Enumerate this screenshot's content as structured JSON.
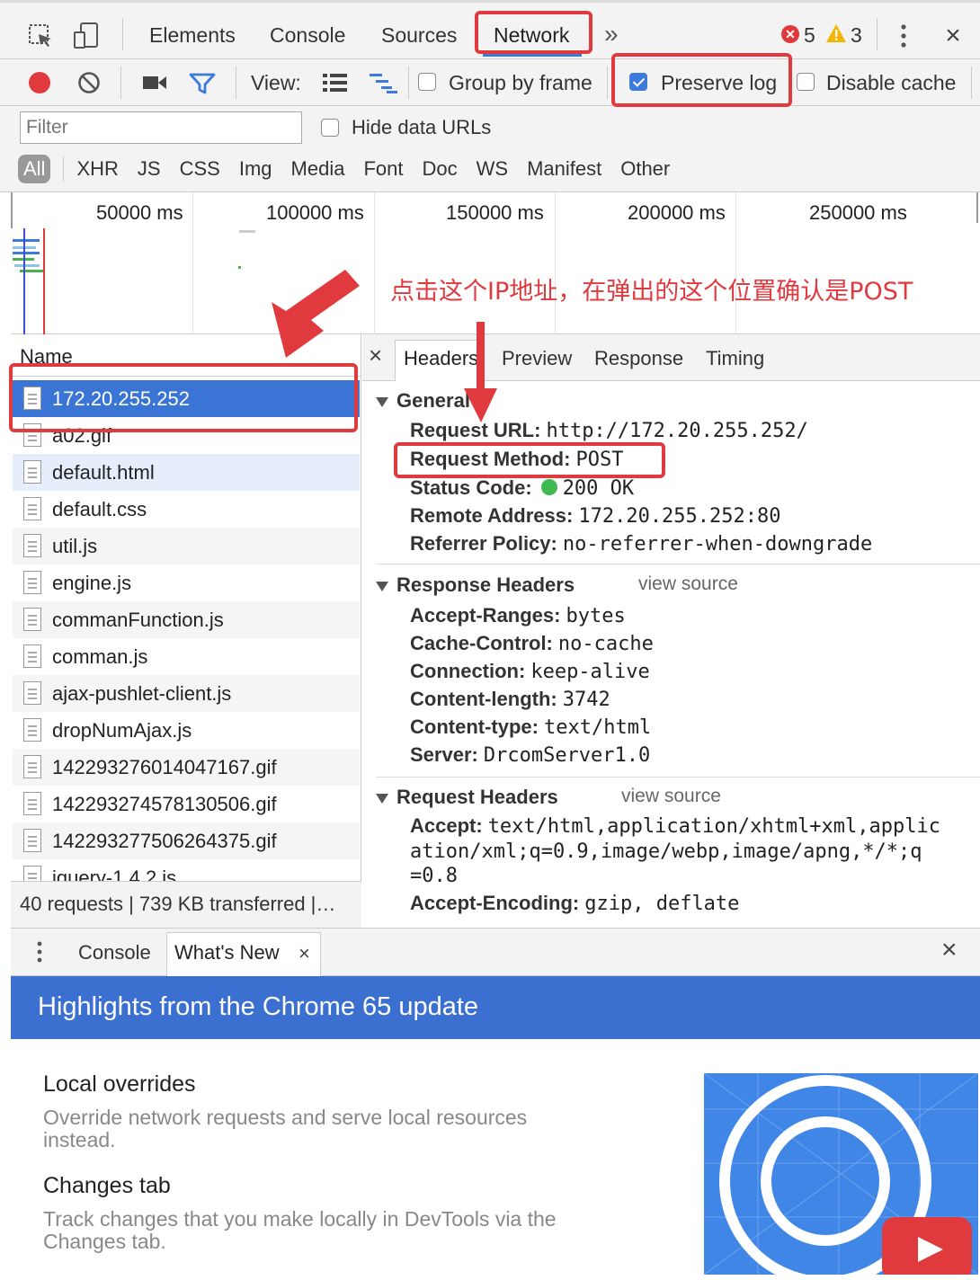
{
  "toolbar": {
    "tabs": [
      "Elements",
      "Console",
      "Sources",
      "Network"
    ],
    "more": "»",
    "errors": "5",
    "warnings": "3"
  },
  "net_toolbar": {
    "view_label": "View:",
    "group_by_frame": "Group by frame",
    "preserve_log": "Preserve log",
    "disable_cache": "Disable cache"
  },
  "filter": {
    "placeholder": "Filter",
    "hide_data_urls": "Hide data URLs",
    "types": [
      "All",
      "XHR",
      "JS",
      "CSS",
      "Img",
      "Media",
      "Font",
      "Doc",
      "WS",
      "Manifest",
      "Other"
    ]
  },
  "timeline": {
    "ticks": [
      "50000 ms",
      "100000 ms",
      "150000 ms",
      "200000 ms",
      "250000 ms"
    ]
  },
  "annotation": {
    "text": "点击这个IP地址，在弹出的这个位置确认是POST",
    "color": "#e0393e"
  },
  "requests": {
    "header": "Name",
    "items": [
      "172.20.255.252",
      "a02.gif",
      "default.html",
      "default.css",
      "util.js",
      "engine.js",
      "commanFunction.js",
      "comman.js",
      "ajax-pushlet-client.js",
      "dropNumAjax.js",
      "142293276014047167.gif",
      "142293274578130506.gif",
      "142293277506264375.gif",
      "jquery-1.4.2.js"
    ],
    "summary": "40 requests | 739 KB transferred |…"
  },
  "details": {
    "tabs": [
      "Headers",
      "Preview",
      "Response",
      "Timing"
    ],
    "close": "×",
    "general": {
      "title": "General",
      "rows": [
        {
          "k": "Request URL:",
          "v": "http://172.20.255.252/"
        },
        {
          "k": "Request Method:",
          "v": "POST"
        },
        {
          "k": "Status Code:",
          "v": "200 OK"
        },
        {
          "k": "Remote Address:",
          "v": "172.20.255.252:80"
        },
        {
          "k": "Referrer Policy:",
          "v": "no-referrer-when-downgrade"
        }
      ]
    },
    "response_headers": {
      "title": "Response Headers",
      "view_source": "view source",
      "rows": [
        {
          "k": "Accept-Ranges:",
          "v": "bytes"
        },
        {
          "k": "Cache-Control:",
          "v": "no-cache"
        },
        {
          "k": "Connection:",
          "v": "keep-alive"
        },
        {
          "k": "Content-length:",
          "v": "3742"
        },
        {
          "k": "Content-type:",
          "v": "text/html"
        },
        {
          "k": "Server:",
          "v": "DrcomServer1.0"
        }
      ]
    },
    "request_headers": {
      "title": "Request Headers",
      "view_source": "view source",
      "accept_k": "Accept:",
      "accept_v1": "text/html,application/xhtml+xml,applic",
      "accept_v2": "ation/xml;q=0.9,image/webp,image/apng,*/*;q",
      "accept_v3": "=0.8",
      "enc_k": "Accept-Encoding:",
      "enc_v": "gzip, deflate"
    }
  },
  "drawer": {
    "tabs": [
      "Console",
      "What's New"
    ],
    "close": "×",
    "banner": "Highlights from the Chrome 65 update",
    "items": [
      {
        "title": "Local overrides",
        "desc1": "Override network requests and serve local resources",
        "desc2": "instead."
      },
      {
        "title": "Changes tab",
        "desc1": "Track changes that you make locally in DevTools via the",
        "desc2": "Changes tab."
      }
    ]
  },
  "colors": {
    "accent": "#3c7bdc",
    "selected": "#3a75d6",
    "banner": "#3b6fd0",
    "annotation": "#e0393e"
  }
}
